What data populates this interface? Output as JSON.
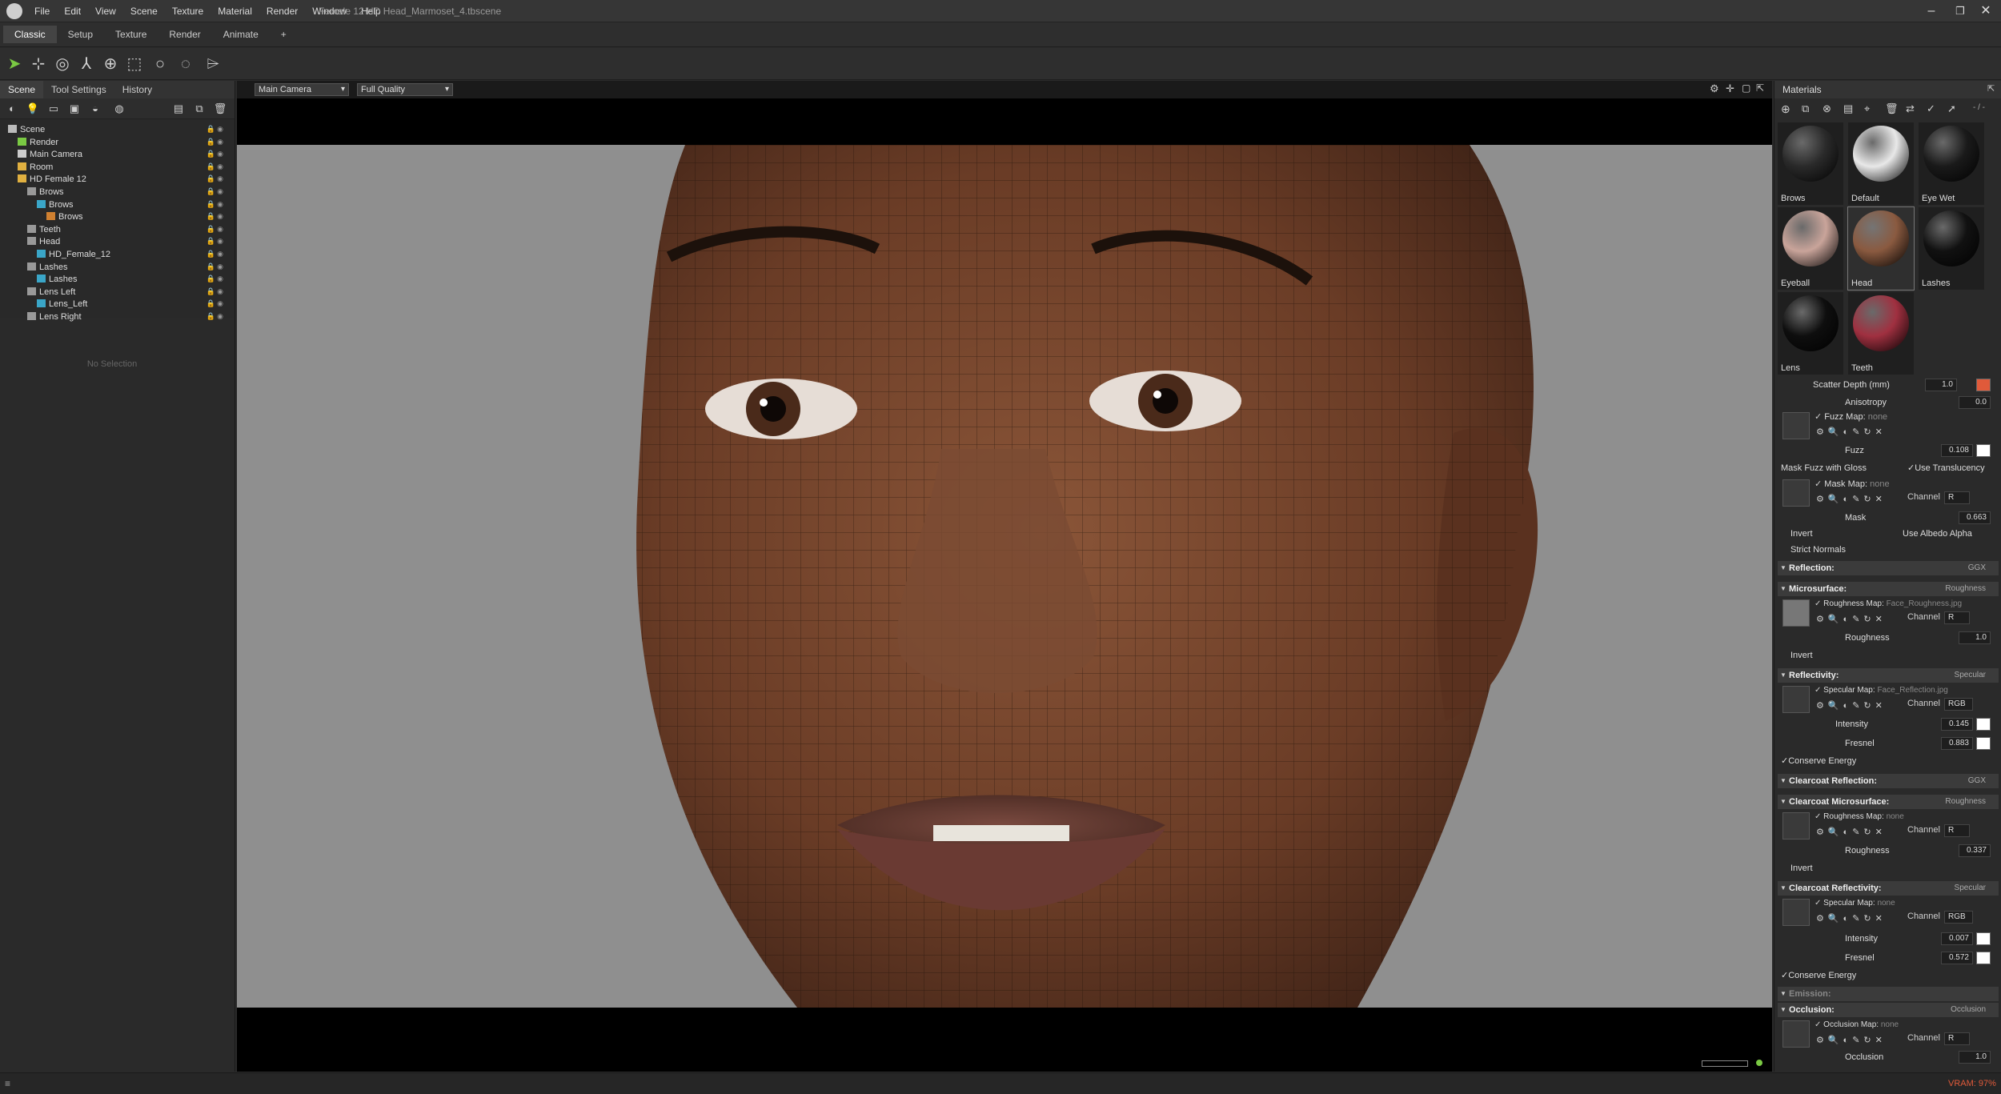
{
  "app": {
    "menu": [
      "File",
      "Edit",
      "View",
      "Scene",
      "Texture",
      "Material",
      "Render",
      "Window",
      "Help"
    ],
    "doc_title": "Female 12 HD Head_Marmoset_4.tbscene",
    "modes": [
      "Classic",
      "Setup",
      "Texture",
      "Render",
      "Animate",
      "+"
    ],
    "active_mode": "Classic"
  },
  "left": {
    "tabs": [
      "Scene",
      "Tool Settings",
      "History"
    ],
    "tree": [
      {
        "label": "Scene",
        "depth": 0,
        "icon": "scene"
      },
      {
        "label": "Render",
        "depth": 1,
        "icon": "render"
      },
      {
        "label": "Main Camera",
        "depth": 1,
        "icon": "camera"
      },
      {
        "label": "Room",
        "depth": 1,
        "icon": "room"
      },
      {
        "label": "HD Female 12",
        "depth": 1,
        "icon": "folder"
      },
      {
        "label": "Brows",
        "depth": 2,
        "icon": "group"
      },
      {
        "label": "Brows",
        "depth": 3,
        "icon": "mesh"
      },
      {
        "label": "Brows",
        "depth": 4,
        "icon": "material"
      },
      {
        "label": "Teeth",
        "depth": 2,
        "icon": "group"
      },
      {
        "label": "Head",
        "depth": 2,
        "icon": "group"
      },
      {
        "label": "HD_Female_12",
        "depth": 3,
        "icon": "mesh"
      },
      {
        "label": "Lashes",
        "depth": 2,
        "icon": "group"
      },
      {
        "label": "Lashes",
        "depth": 3,
        "icon": "mesh"
      },
      {
        "label": "Lens Left",
        "depth": 2,
        "icon": "group"
      },
      {
        "label": "Lens_Left",
        "depth": 3,
        "icon": "mesh"
      },
      {
        "label": "Lens Right",
        "depth": 2,
        "icon": "group"
      }
    ],
    "no_selection": "No Selection"
  },
  "viewport": {
    "camera": "Main Camera",
    "quality": "Full Quality"
  },
  "materials": {
    "title": "Materials",
    "counter": "- / -",
    "items": [
      {
        "label": "Brows",
        "color": "#2a2a2a"
      },
      {
        "label": "Default",
        "color": "#e8e8e8"
      },
      {
        "label": "Eye Wet",
        "color": "#1a1a1a"
      },
      {
        "label": "Eyeball",
        "color": "#c9a49a"
      },
      {
        "label": "Head",
        "color": "#8a5a40"
      },
      {
        "label": "Lashes",
        "color": "#111"
      },
      {
        "label": "Lens",
        "color": "#0e0e0e"
      },
      {
        "label": "Teeth",
        "color": "#a03040"
      }
    ],
    "props": {
      "scatter_depth_label": "Scatter Depth (mm)",
      "scatter_depth": "1.0",
      "anisotropy_label": "Anisotropy",
      "anisotropy": "0.0",
      "fuzz_map_label": "Fuzz Map:",
      "none": "none",
      "fuzz_label": "Fuzz",
      "fuzz": "0.108",
      "mask_fuzz": "Mask Fuzz with Gloss",
      "use_translucency": "Use Translucency",
      "mask_map_label": "Mask Map:",
      "channel": "Channel",
      "ch_r": "R",
      "ch_rgb": "RGB",
      "mask_label": "Mask",
      "mask": "0.663",
      "invert": "Invert",
      "use_albedo_alpha": "Use Albedo Alpha",
      "strict_normals": "Strict Normals",
      "reflection": "Reflection:",
      "ggx": "GGX",
      "microsurface": "Microsurface:",
      "roughness_mode": "Roughness",
      "roughness_map_label": "Roughness Map:",
      "roughness_map": "Face_Roughness.jpg",
      "roughness_label": "Roughness",
      "roughness": "1.0",
      "reflectivity": "Reflectivity:",
      "specular_mode": "Specular",
      "specular_map_label": "Specular Map:",
      "specular_map": "Face_Reflection.jpg",
      "intensity_label": "Intensity",
      "intensity": "0.145",
      "fresnel_label": "Fresnel",
      "fresnel": "0.883",
      "conserve_energy": "Conserve Energy",
      "cc_reflection": "Clearcoat Reflection:",
      "cc_microsurface": "Clearcoat Microsurface:",
      "cc_roughness": "0.337",
      "cc_reflectivity": "Clearcoat Reflectivity:",
      "cc_intensity": "0.007",
      "cc_fresnel": "0.572",
      "emission": "Emission:",
      "occlusion": "Occlusion:",
      "occlusion_mode": "Occlusion",
      "occlusion_map_label": "Occlusion Map:",
      "occlusion_label": "Occlusion",
      "occlusion_val": "1.0"
    }
  },
  "status": {
    "vram": "VRAM: 97%"
  },
  "colors": {
    "scatter_swatch": "#e05a3a",
    "accent_green": "#7ac943"
  }
}
